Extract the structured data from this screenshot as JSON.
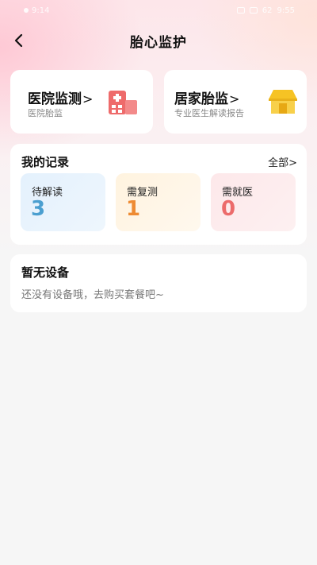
{
  "status_bar": {
    "left_text": "9:14",
    "right_text": "9:55",
    "battery": "62"
  },
  "nav": {
    "title": "胎心监护",
    "back_icon": "chevron-left-icon"
  },
  "service_cards": [
    {
      "title": "医院监测",
      "arrow": ">",
      "subtitle": "医院胎监",
      "icon": "hospital-icon",
      "icon_color": "#ee6b6b"
    },
    {
      "title": "居家胎监",
      "arrow": ">",
      "subtitle": "专业医生解读报告",
      "icon": "house-icon",
      "icon_color": "#f6c324"
    }
  ],
  "records": {
    "title": "我的记录",
    "all_label": "全部>",
    "stats": [
      {
        "label": "待解读",
        "value": "3",
        "color": "#4b9fd0"
      },
      {
        "label": "需复测",
        "value": "1",
        "color": "#ee8b33"
      },
      {
        "label": "需就医",
        "value": "0",
        "color": "#ec6b6b"
      }
    ]
  },
  "devices": {
    "title": "暂无设备",
    "message": "还没有设备哦，去购买套餐吧~"
  }
}
